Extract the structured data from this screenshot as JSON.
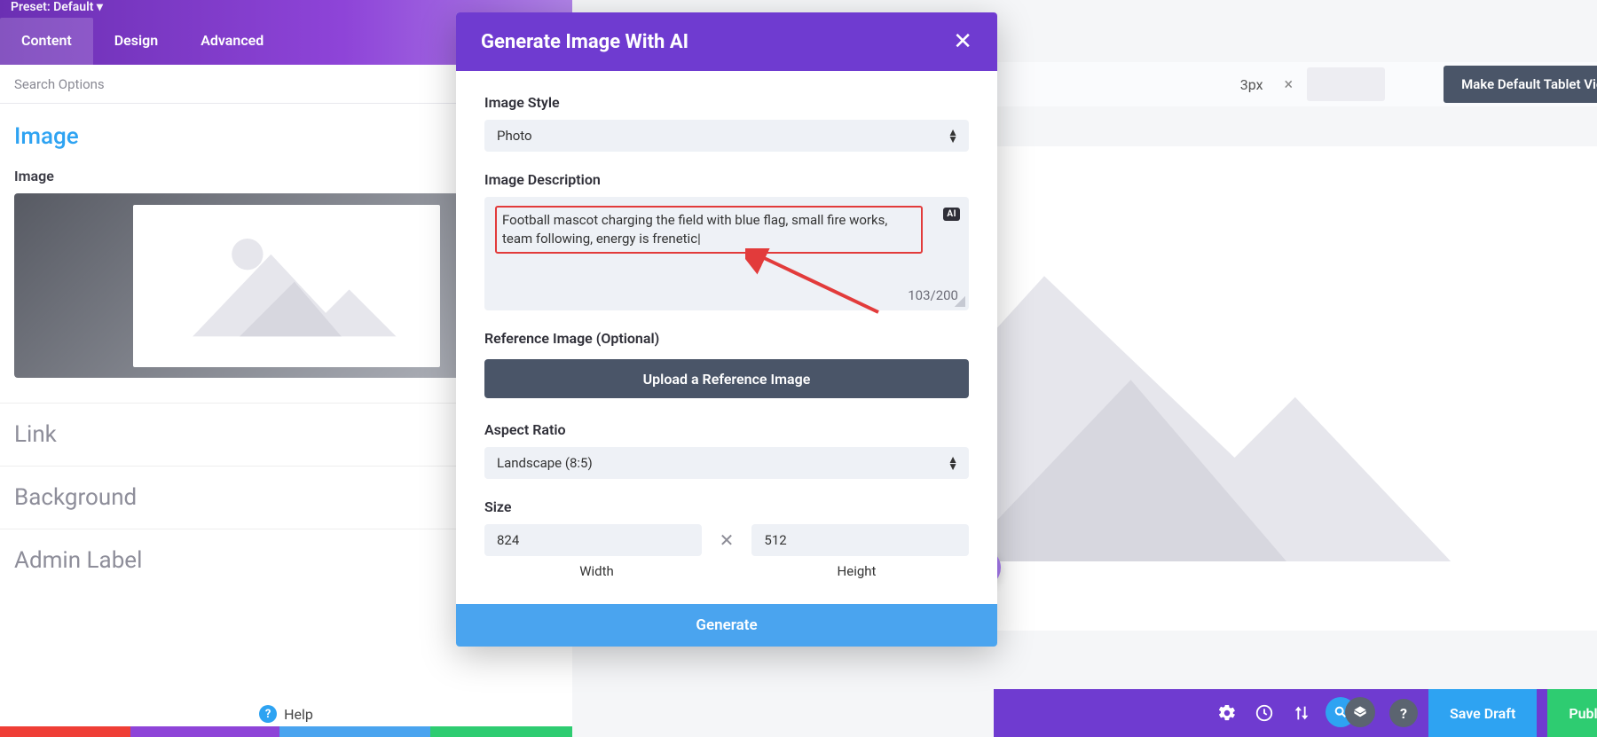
{
  "preset": {
    "label": "Preset: Default ▾"
  },
  "tabs": {
    "content": "Content",
    "design": "Design",
    "advanced": "Advanced"
  },
  "search": {
    "placeholder": "Search Options"
  },
  "image_section": {
    "title": "Image",
    "field_label": "Image"
  },
  "collapsed": {
    "link": "Link",
    "background": "Background",
    "admin_label": "Admin Label"
  },
  "help": {
    "label": "Help"
  },
  "top_right": {
    "px": "3px",
    "default_btn": "Make Default Tablet View"
  },
  "bottom": {
    "save": "Save Draft",
    "publish": "Publish"
  },
  "modal": {
    "title": "Generate Image With AI",
    "style_label": "Image Style",
    "style_value": "Photo",
    "desc_label": "Image Description",
    "desc_value": "Football mascot charging the field with blue flag, small fire works, team following, energy is frenetic",
    "char_count": "103/200",
    "ai_badge": "AI",
    "ref_label": "Reference Image (Optional)",
    "ref_button": "Upload a Reference Image",
    "aspect_label": "Aspect Ratio",
    "aspect_value": "Landscape (8:5)",
    "size_label": "Size",
    "width_value": "824",
    "height_value": "512",
    "width_label": "Width",
    "height_label": "Height",
    "generate": "Generate"
  }
}
